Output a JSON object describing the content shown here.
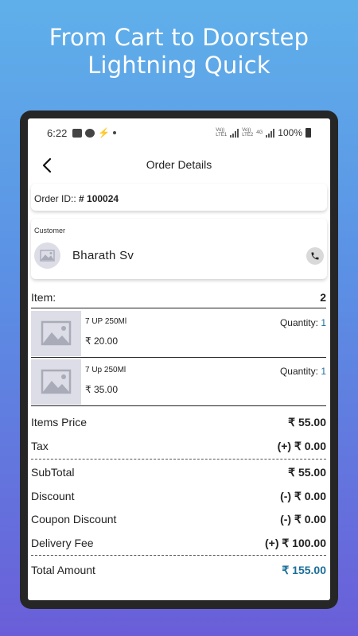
{
  "headline": {
    "line1": "From Cart to Doorstep",
    "line2": "Lightning Quick"
  },
  "status_bar": {
    "time": "6:22",
    "battery": "100%",
    "volte1": "Vo)) LTE1",
    "volte2": "Vo)) LTE2",
    "net": "4G"
  },
  "app_bar": {
    "title": "Order Details"
  },
  "order": {
    "id_label": "Order ID:: ",
    "id_value": "# 100024"
  },
  "customer": {
    "label": "Customer",
    "name": "Bharath Sv"
  },
  "items_header": {
    "label": "Item:",
    "count": "2"
  },
  "items": [
    {
      "name": "7 UP 250Ml",
      "price": "₹ 20.00",
      "qty_label": "Quantity: ",
      "qty": "1"
    },
    {
      "name": "7 Up 250Ml",
      "price": "₹ 35.00",
      "qty_label": "Quantity: ",
      "qty": "1"
    }
  ],
  "summary": {
    "items_price_label": "Items Price",
    "items_price": "₹ 55.00",
    "tax_label": "Tax",
    "tax": "(+) ₹ 0.00",
    "subtotal_label": "SubTotal",
    "subtotal": "₹ 55.00",
    "discount_label": "Discount",
    "discount": "(-) ₹ 0.00",
    "coupon_label": "Coupon Discount",
    "coupon": "(-) ₹ 0.00",
    "delivery_label": "Delivery Fee",
    "delivery": "(+) ₹ 100.00",
    "total_label": "Total Amount",
    "total": "₹ 155.00"
  },
  "colors": {
    "accent": "#1b6e98",
    "bg_top": "#5fb0ea",
    "bg_bottom": "#6a5ed8"
  }
}
